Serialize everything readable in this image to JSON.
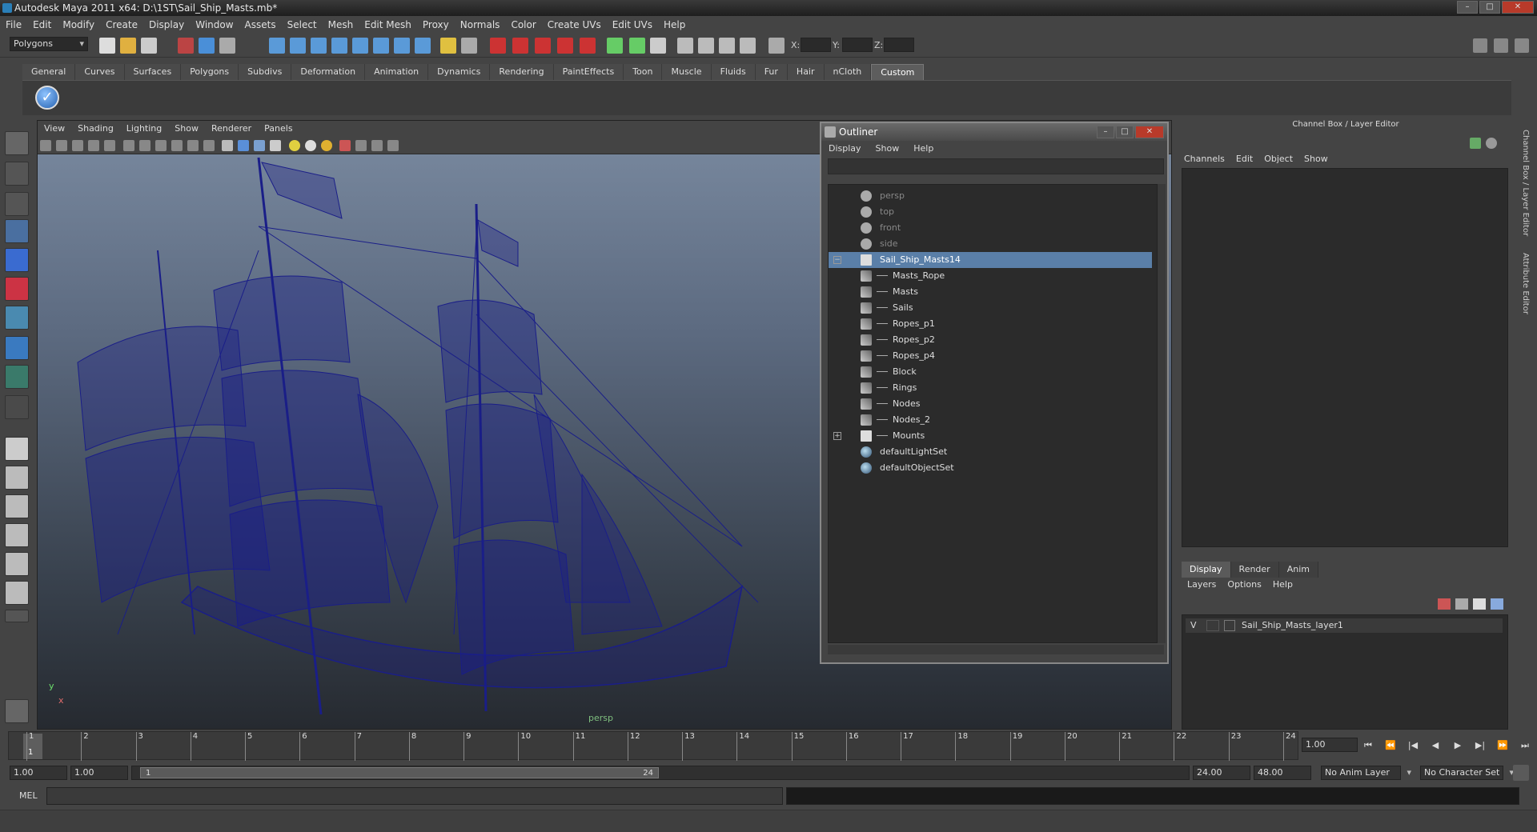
{
  "window": {
    "title": "Autodesk Maya 2011 x64: D:\\1ST\\Sail_Ship_Masts.mb*"
  },
  "menubar": [
    "File",
    "Edit",
    "Modify",
    "Create",
    "Display",
    "Window",
    "Assets",
    "Select",
    "Mesh",
    "Edit Mesh",
    "Proxy",
    "Normals",
    "Color",
    "Create UVs",
    "Edit UVs",
    "Help"
  ],
  "statusline": {
    "menuset": "Polygons",
    "x_label": "X:",
    "y_label": "Y:",
    "z_label": "Z:"
  },
  "shelf": {
    "tabs": [
      "General",
      "Curves",
      "Surfaces",
      "Polygons",
      "Subdivs",
      "Deformation",
      "Animation",
      "Dynamics",
      "Rendering",
      "PaintEffects",
      "Toon",
      "Muscle",
      "Fluids",
      "Fur",
      "Hair",
      "nCloth",
      "Custom"
    ],
    "active": "Custom"
  },
  "viewport": {
    "menu": [
      "View",
      "Shading",
      "Lighting",
      "Show",
      "Renderer",
      "Panels"
    ],
    "camera_label": "persp",
    "axis_y": "y",
    "axis_x": "x"
  },
  "outliner": {
    "title": "Outliner",
    "menu": [
      "Display",
      "Show",
      "Help"
    ],
    "items": [
      {
        "label": "persp",
        "depth": 0,
        "dim": true,
        "icon": "camera-icon"
      },
      {
        "label": "top",
        "depth": 0,
        "dim": true,
        "icon": "camera-icon"
      },
      {
        "label": "front",
        "depth": 0,
        "dim": true,
        "icon": "camera-icon"
      },
      {
        "label": "side",
        "depth": 0,
        "dim": true,
        "icon": "camera-icon"
      },
      {
        "label": "Sail_Ship_Masts14",
        "depth": 0,
        "selected": true,
        "expander": "−",
        "icon": "group-icon"
      },
      {
        "label": "Masts_Rope",
        "depth": 1,
        "icon": "mesh-icon"
      },
      {
        "label": "Masts",
        "depth": 1,
        "icon": "mesh-icon"
      },
      {
        "label": "Sails",
        "depth": 1,
        "icon": "mesh-icon"
      },
      {
        "label": "Ropes_p1",
        "depth": 1,
        "icon": "mesh-icon"
      },
      {
        "label": "Ropes_p2",
        "depth": 1,
        "icon": "mesh-icon"
      },
      {
        "label": "Ropes_p4",
        "depth": 1,
        "icon": "mesh-icon"
      },
      {
        "label": "Block",
        "depth": 1,
        "icon": "mesh-icon"
      },
      {
        "label": "Rings",
        "depth": 1,
        "icon": "mesh-icon"
      },
      {
        "label": "Nodes",
        "depth": 1,
        "icon": "mesh-icon"
      },
      {
        "label": "Nodes_2",
        "depth": 1,
        "icon": "mesh-icon"
      },
      {
        "label": "Mounts",
        "depth": 1,
        "expander": "+",
        "icon": "group-icon"
      },
      {
        "label": "defaultLightSet",
        "depth": 0,
        "icon": "set-icon"
      },
      {
        "label": "defaultObjectSet",
        "depth": 0,
        "icon": "set-icon"
      }
    ]
  },
  "channelbox": {
    "title": "Channel Box / Layer Editor",
    "menu": [
      "Channels",
      "Edit",
      "Object",
      "Show"
    ],
    "layer_tabs": [
      "Display",
      "Render",
      "Anim"
    ],
    "layer_tab_active": "Display",
    "layer_menu": [
      "Layers",
      "Options",
      "Help"
    ],
    "layers": [
      {
        "visible": "V",
        "name": "Sail_Ship_Masts_layer1"
      }
    ],
    "side_tabs": [
      "Channel Box / Layer Editor",
      "Attribute Editor"
    ]
  },
  "timeslider": {
    "ticks": [
      "1",
      "2",
      "3",
      "4",
      "5",
      "6",
      "7",
      "8",
      "9",
      "10",
      "11",
      "12",
      "13",
      "14",
      "15",
      "16",
      "17",
      "18",
      "19",
      "20",
      "21",
      "22",
      "23",
      "24"
    ],
    "current_marker": "1",
    "current_time": "1.00"
  },
  "rangeslider": {
    "start_time": "1.00",
    "playback_start": "1.00",
    "range_start_label": "1",
    "range_end_label": "24",
    "playback_end": "24.00",
    "end_time": "48.00",
    "anim_layer": "No Anim Layer",
    "character_set": "No Character Set"
  },
  "command": {
    "label": "MEL"
  }
}
